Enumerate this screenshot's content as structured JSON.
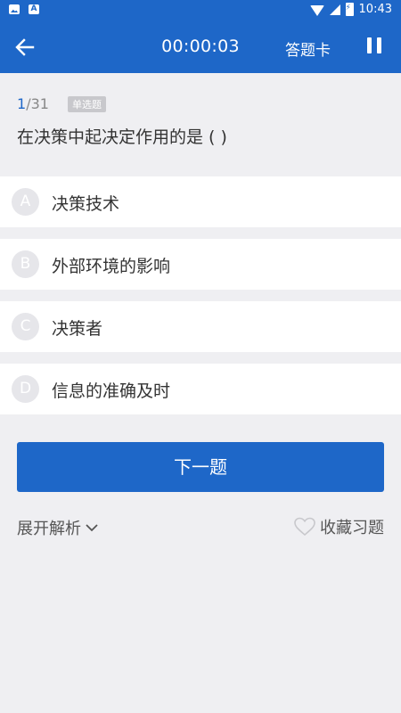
{
  "status_bar": {
    "time": "10:43",
    "icons": [
      "image-icon",
      "a-icon",
      "wifi-icon",
      "signal-icon",
      "battery-icon"
    ]
  },
  "header": {
    "back_icon": "arrow-left-icon",
    "timer": "00:00:03",
    "answer_card": "答题卡",
    "pause_icon": "pause-icon"
  },
  "question": {
    "current": "1",
    "total": "/31",
    "type": "单选题",
    "text": "在决策中起决定作用的是 ( )"
  },
  "options": [
    {
      "letter": "A",
      "text": "决策技术"
    },
    {
      "letter": "B",
      "text": "外部环境的影响"
    },
    {
      "letter": "C",
      "text": "决策者"
    },
    {
      "letter": "D",
      "text": "信息的准确及时"
    }
  ],
  "actions": {
    "next": "下一题",
    "expand_analysis": "展开解析",
    "favorite": "收藏习题"
  },
  "colors": {
    "primary": "#1e67c8",
    "background": "#efeff2"
  }
}
